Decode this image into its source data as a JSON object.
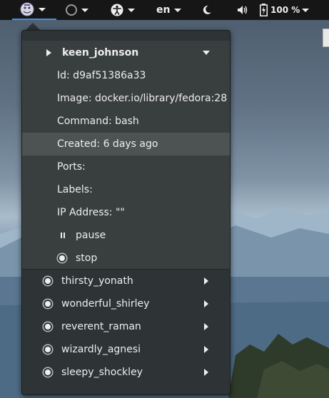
{
  "topbar": {
    "language": "en",
    "battery_percent": "100 %",
    "icons": [
      "docker-whale-icon",
      "circle-status-icon",
      "accessibility-icon",
      "night-light-moon-icon",
      "volume-icon",
      "battery-charging-icon",
      "system-menu-arrow-icon"
    ]
  },
  "menu": {
    "expanded_container": {
      "name": "keen_johnson",
      "details": {
        "id": "Id: d9af51386a33",
        "image": "Image: docker.io/library/fedora:28",
        "command": "Command: bash",
        "created": "Created: 6 days ago",
        "ports": "Ports:",
        "labels": "Labels:",
        "ip_address": "IP Address: \"\""
      },
      "actions": {
        "pause": "pause",
        "stop": "stop"
      }
    },
    "containers": [
      {
        "name": "thirsty_yonath"
      },
      {
        "name": "wonderful_shirley"
      },
      {
        "name": "reverent_raman"
      },
      {
        "name": "wizardly_agnesi"
      },
      {
        "name": "sleepy_shockley"
      }
    ]
  }
}
